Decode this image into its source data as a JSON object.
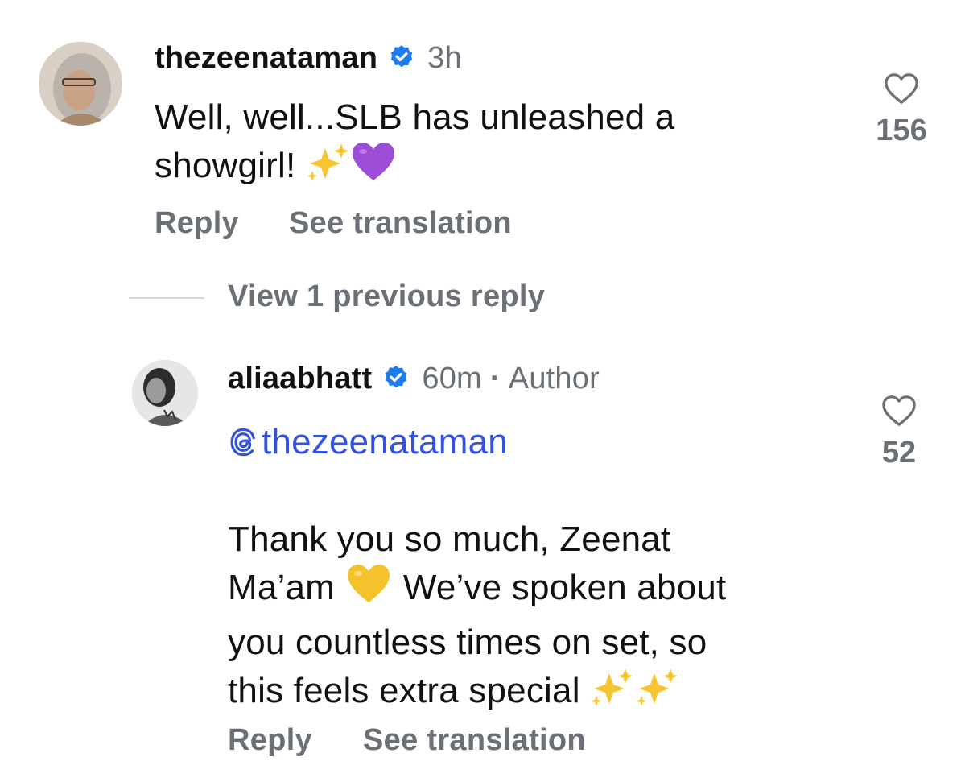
{
  "comments": [
    {
      "username": "thezeenataman",
      "time": "3h",
      "text_line1": "Well, well...SLB has unleashed a",
      "text_line2": "showgirl!",
      "emojis": [
        "sparkles-emoji",
        "purple-heart-emoji"
      ],
      "likes": "156",
      "reply_label": "Reply",
      "translate_label": "See translation"
    },
    {
      "username": "aliaabhatt",
      "time": "60m",
      "author_label": "Author",
      "mention": "thezeenataman",
      "text_line1": "Thank you so much, Zeenat",
      "text_line2a": "Ma’am",
      "text_line2b": "We’ve spoken about",
      "text_line3": "you countless times on set, so",
      "text_line4": "this feels extra special",
      "emojis": [
        "yellow-heart-emoji",
        "sparkles-emoji",
        "sparkles-emoji"
      ],
      "likes": "52",
      "reply_label": "Reply",
      "translate_label": "See translation"
    }
  ],
  "view_replies_label": "View 1 previous reply",
  "colors": {
    "text": "#111111",
    "muted": "#6b6f76",
    "link": "#3451e0",
    "verified": "#1d7bf0"
  }
}
